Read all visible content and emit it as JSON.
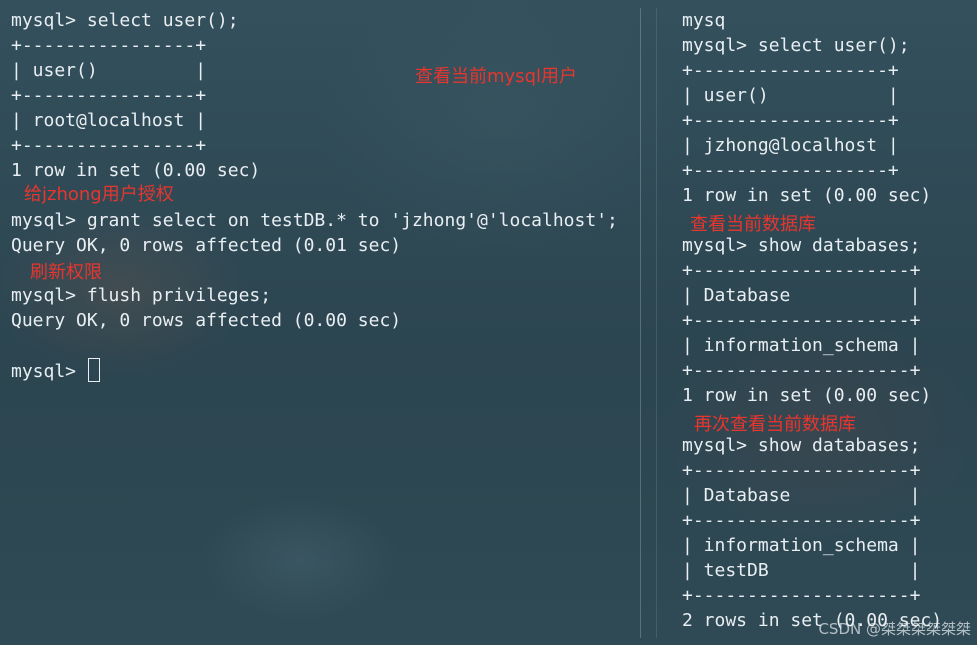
{
  "colors": {
    "background": "#2f4853",
    "terminal_text": "#e8eef2",
    "annotation_red": "#e8352e"
  },
  "left_terminal": {
    "lines": [
      "mysql> select user();",
      "+----------------+",
      "| user()         |",
      "+----------------+",
      "| root@localhost |",
      "+----------------+",
      "1 row in set (0.00 sec)",
      "",
      "mysql> grant select on testDB.* to 'jzhong'@'localhost';",
      "Query OK, 0 rows affected (0.01 sec)",
      "",
      "mysql> flush privileges;",
      "Query OK, 0 rows affected (0.00 sec)",
      "",
      "mysql> "
    ],
    "cursor_icon": "block-cursor"
  },
  "right_terminal": {
    "lines": [
      "mysq",
      "mysql> select user();",
      "+------------------+",
      "| user()           |",
      "+------------------+",
      "| jzhong@localhost |",
      "+------------------+",
      "1 row in set (0.00 sec)",
      "",
      "mysql> show databases;",
      "+--------------------+",
      "| Database           |",
      "+--------------------+",
      "| information_schema |",
      "+--------------------+",
      "1 row in set (0.00 sec)",
      "",
      "mysql> show databases;",
      "+--------------------+",
      "| Database           |",
      "+--------------------+",
      "| information_schema |",
      "| testDB             |",
      "+--------------------+",
      "2 rows in set (0.00 sec)"
    ]
  },
  "annotations": {
    "check_current_user": "查看当前mysql用户",
    "grant_jzhong": "给jzhong用户授权",
    "refresh_privileges": "刷新权限",
    "check_current_db": "查看当前数据库",
    "recheck_current_db": "再次查看当前数据库"
  },
  "watermark": "CSDN @桀桀桀桀桀桀"
}
